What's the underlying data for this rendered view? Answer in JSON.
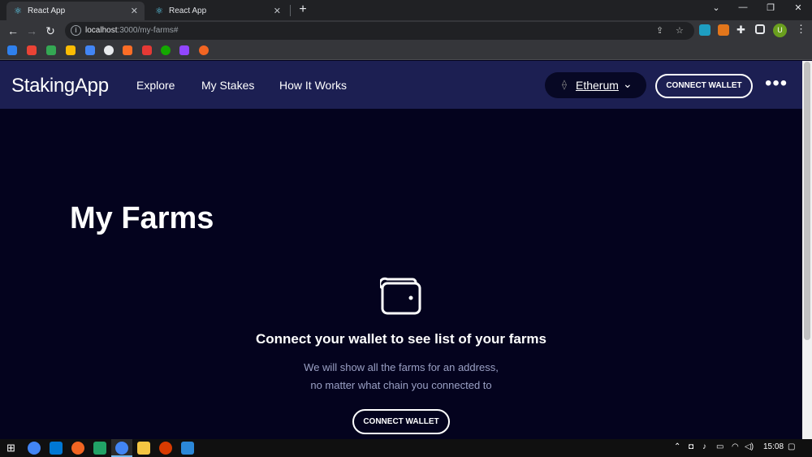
{
  "browser": {
    "tabs": [
      {
        "title": "React App",
        "active": true
      },
      {
        "title": "React App",
        "active": false
      }
    ],
    "url_host": "localhost",
    "url_path": ":3000/my-farms#",
    "avatar_letter": "U"
  },
  "app": {
    "logo": "StakingApp",
    "nav": [
      "Explore",
      "My Stakes",
      "How It Works"
    ],
    "chain": "Etherum",
    "connect_label": "CONNECT WALLET",
    "more_label": "•••"
  },
  "main": {
    "title": "My Farms",
    "empty_title": "Connect your wallet to see list of your farms",
    "empty_line1": "We will show all the farms for an address,",
    "empty_line2": "no matter what chain you connected to",
    "connect_label": "CONNECT WALLET"
  },
  "taskbar": {
    "clock": "15:08"
  },
  "colors": {
    "header_bg": "#1c1f52",
    "page_bg": "#04031e",
    "chain_bg": "#070824",
    "subtext": "#9aa0c4"
  }
}
